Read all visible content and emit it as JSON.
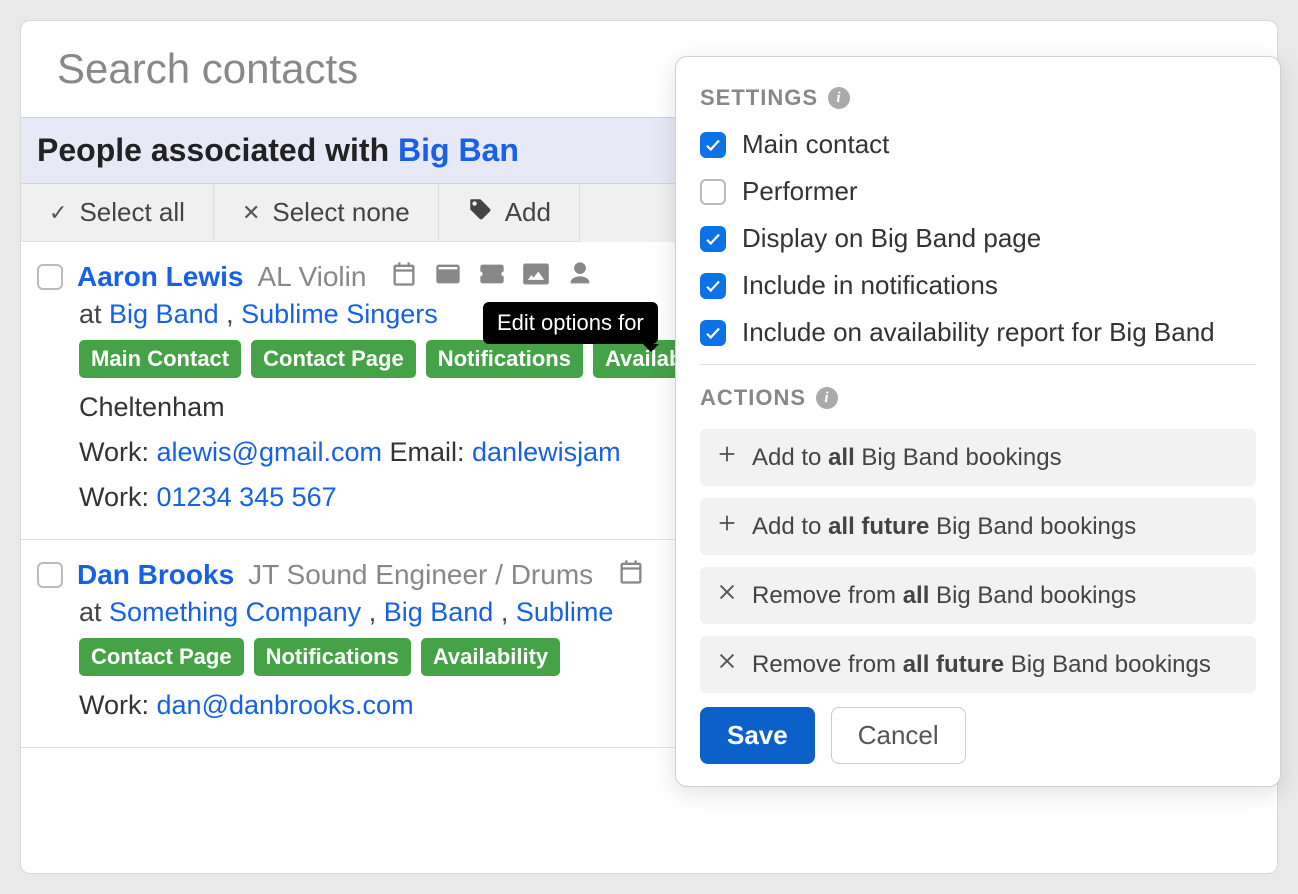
{
  "search": {
    "placeholder": "Search contacts"
  },
  "header": {
    "prefix": "People associated with ",
    "link": "Big Ban"
  },
  "toolbar": {
    "select_all": "Select all",
    "select_none": "Select none",
    "add": "Add "
  },
  "tooltip": "Edit options for ",
  "contacts": [
    {
      "name": "Aaron Lewis",
      "role": "AL Violin",
      "at_pref": "at ",
      "companies": [
        "Big Band",
        "Sublime Singers"
      ],
      "badges": [
        "Main Contact",
        "Contact Page",
        "Notifications",
        "Availabil"
      ],
      "city": "Cheltenham",
      "line_work_email_label": "Work: ",
      "work_email": "alewis@gmail.com",
      "line_email_label": "  Email: ",
      "email2": "danlewisjam",
      "line_work_phone_label": "Work: ",
      "phone": "01234 345 567"
    },
    {
      "name": "Dan Brooks",
      "role": "JT Sound Engineer / Drums",
      "at_pref": "at ",
      "companies": [
        "Something Company",
        "Big Band",
        "Sublime"
      ],
      "badges": [
        "Contact Page",
        "Notifications",
        "Availability"
      ],
      "line_work_email_label": "Work: ",
      "work_email": "dan@danbrooks.com"
    }
  ],
  "popover": {
    "settings_title": "SETTINGS",
    "options": [
      {
        "label": "Main contact",
        "checked": true
      },
      {
        "label": "Performer",
        "checked": false
      },
      {
        "label": "Display on Big Band page",
        "checked": true
      },
      {
        "label": "Include in notifications",
        "checked": true
      },
      {
        "label": "Include on availability report for Big Band",
        "checked": true
      }
    ],
    "actions_title": "ACTIONS",
    "actions": [
      {
        "icon": "plus",
        "pre": "Add to ",
        "bold": "all",
        "post": " Big Band bookings"
      },
      {
        "icon": "plus",
        "pre": "Add to ",
        "bold": "all future",
        "post": " Big Band bookings"
      },
      {
        "icon": "x",
        "pre": "Remove from ",
        "bold": "all",
        "post": " Big Band bookings"
      },
      {
        "icon": "x",
        "pre": "Remove from ",
        "bold": "all future",
        "post": " Big Band bookings"
      }
    ],
    "save": "Save",
    "cancel": "Cancel"
  }
}
